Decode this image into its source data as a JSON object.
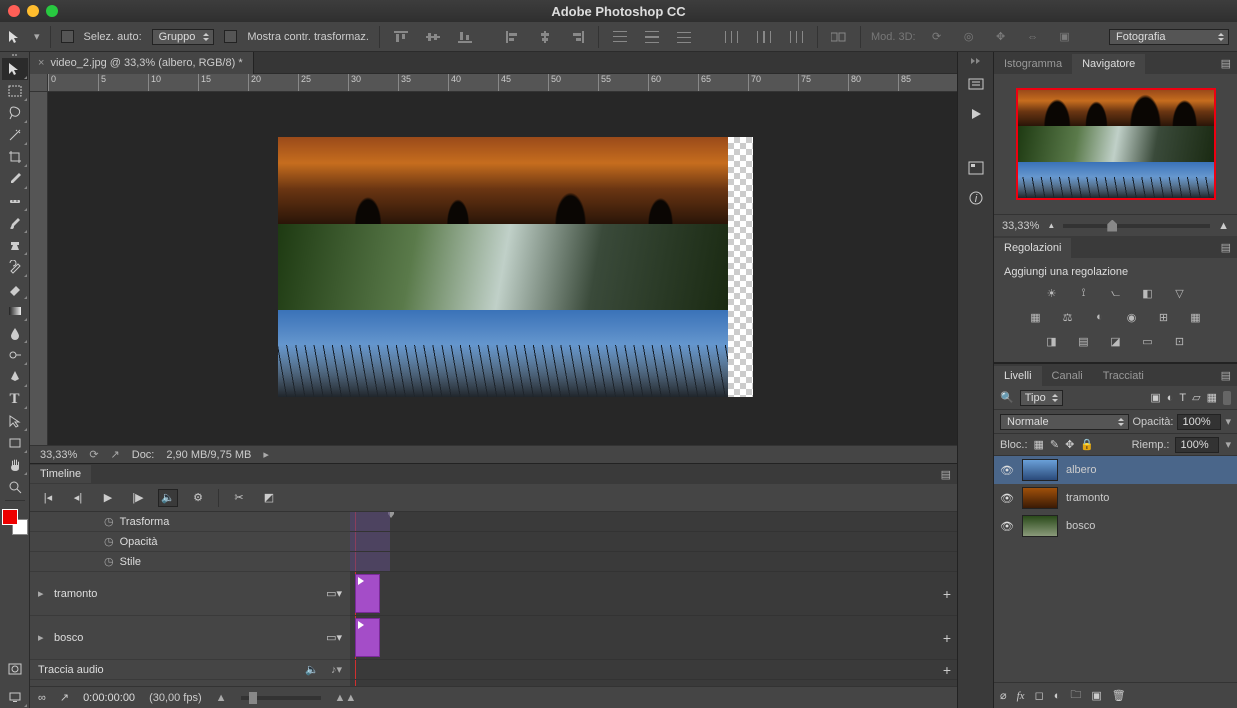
{
  "app": {
    "title": "Adobe Photoshop CC"
  },
  "options": {
    "autoselect_label": "Selez. auto:",
    "group_label": "Gruppo",
    "transform_label": "Mostra contr. trasformaz.",
    "mode3d_label": "Mod. 3D:",
    "workspace": "Fotografia"
  },
  "document": {
    "tab_title": "video_2.jpg @ 33,3% (albero, RGB/8) *"
  },
  "ruler_ticks": [
    "0",
    "5",
    "10",
    "15",
    "20",
    "25",
    "30",
    "35",
    "40",
    "45",
    "50",
    "55",
    "60",
    "65",
    "70",
    "75",
    "80",
    "85"
  ],
  "status": {
    "zoom": "33,33%",
    "docsize_label": "Doc:",
    "docsize": "2,90 MB/9,75 MB"
  },
  "timeline": {
    "title": "Timeline",
    "props": [
      "Trasforma",
      "Opacità",
      "Stile"
    ],
    "layers": [
      "tramonto",
      "bosco"
    ],
    "audio_label": "Traccia audio",
    "timecode": "0:00:00:00",
    "fps": "(30,00 fps)"
  },
  "navigator": {
    "tab_histogram": "Istogramma",
    "tab_navigator": "Navigatore",
    "zoom": "33,33%"
  },
  "adjustments": {
    "title": "Regolazioni",
    "add_label": "Aggiungi una regolazione"
  },
  "layers_panel": {
    "tab_layers": "Livelli",
    "tab_channels": "Canali",
    "tab_paths": "Tracciati",
    "filter_kind": "Tipo",
    "blend_mode": "Normale",
    "opacity_label": "Opacità:",
    "opacity_value": "100%",
    "lock_label": "Bloc.:",
    "fill_label": "Riemp.:",
    "fill_value": "100%",
    "layers": [
      {
        "name": "albero"
      },
      {
        "name": "tramonto"
      },
      {
        "name": "bosco"
      }
    ]
  }
}
